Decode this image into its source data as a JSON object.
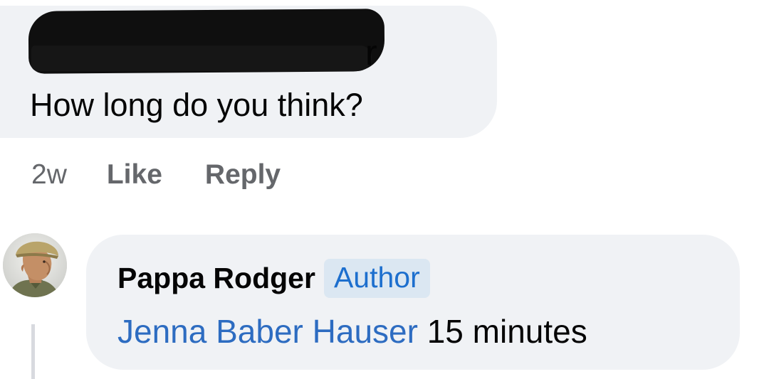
{
  "first_comment": {
    "author_redacted_visible": "r",
    "text": "How long do you think?",
    "time": "2w",
    "like_label": "Like",
    "reply_label": "Reply"
  },
  "reply_comment": {
    "author": "Pappa Rodger",
    "badge": "Author",
    "mention": "Jenna Baber Hauser",
    "text": "15 minutes"
  },
  "colors": {
    "bubble": "#f0f2f5",
    "text": "#050505",
    "muted": "#65676b",
    "mention": "#2d6cc1",
    "badge_bg": "#dbe7f2",
    "badge_text": "#1d6fce",
    "redaction": "#0f0f0f"
  },
  "icons": {
    "avatar": "soldier-profile-avatar"
  }
}
